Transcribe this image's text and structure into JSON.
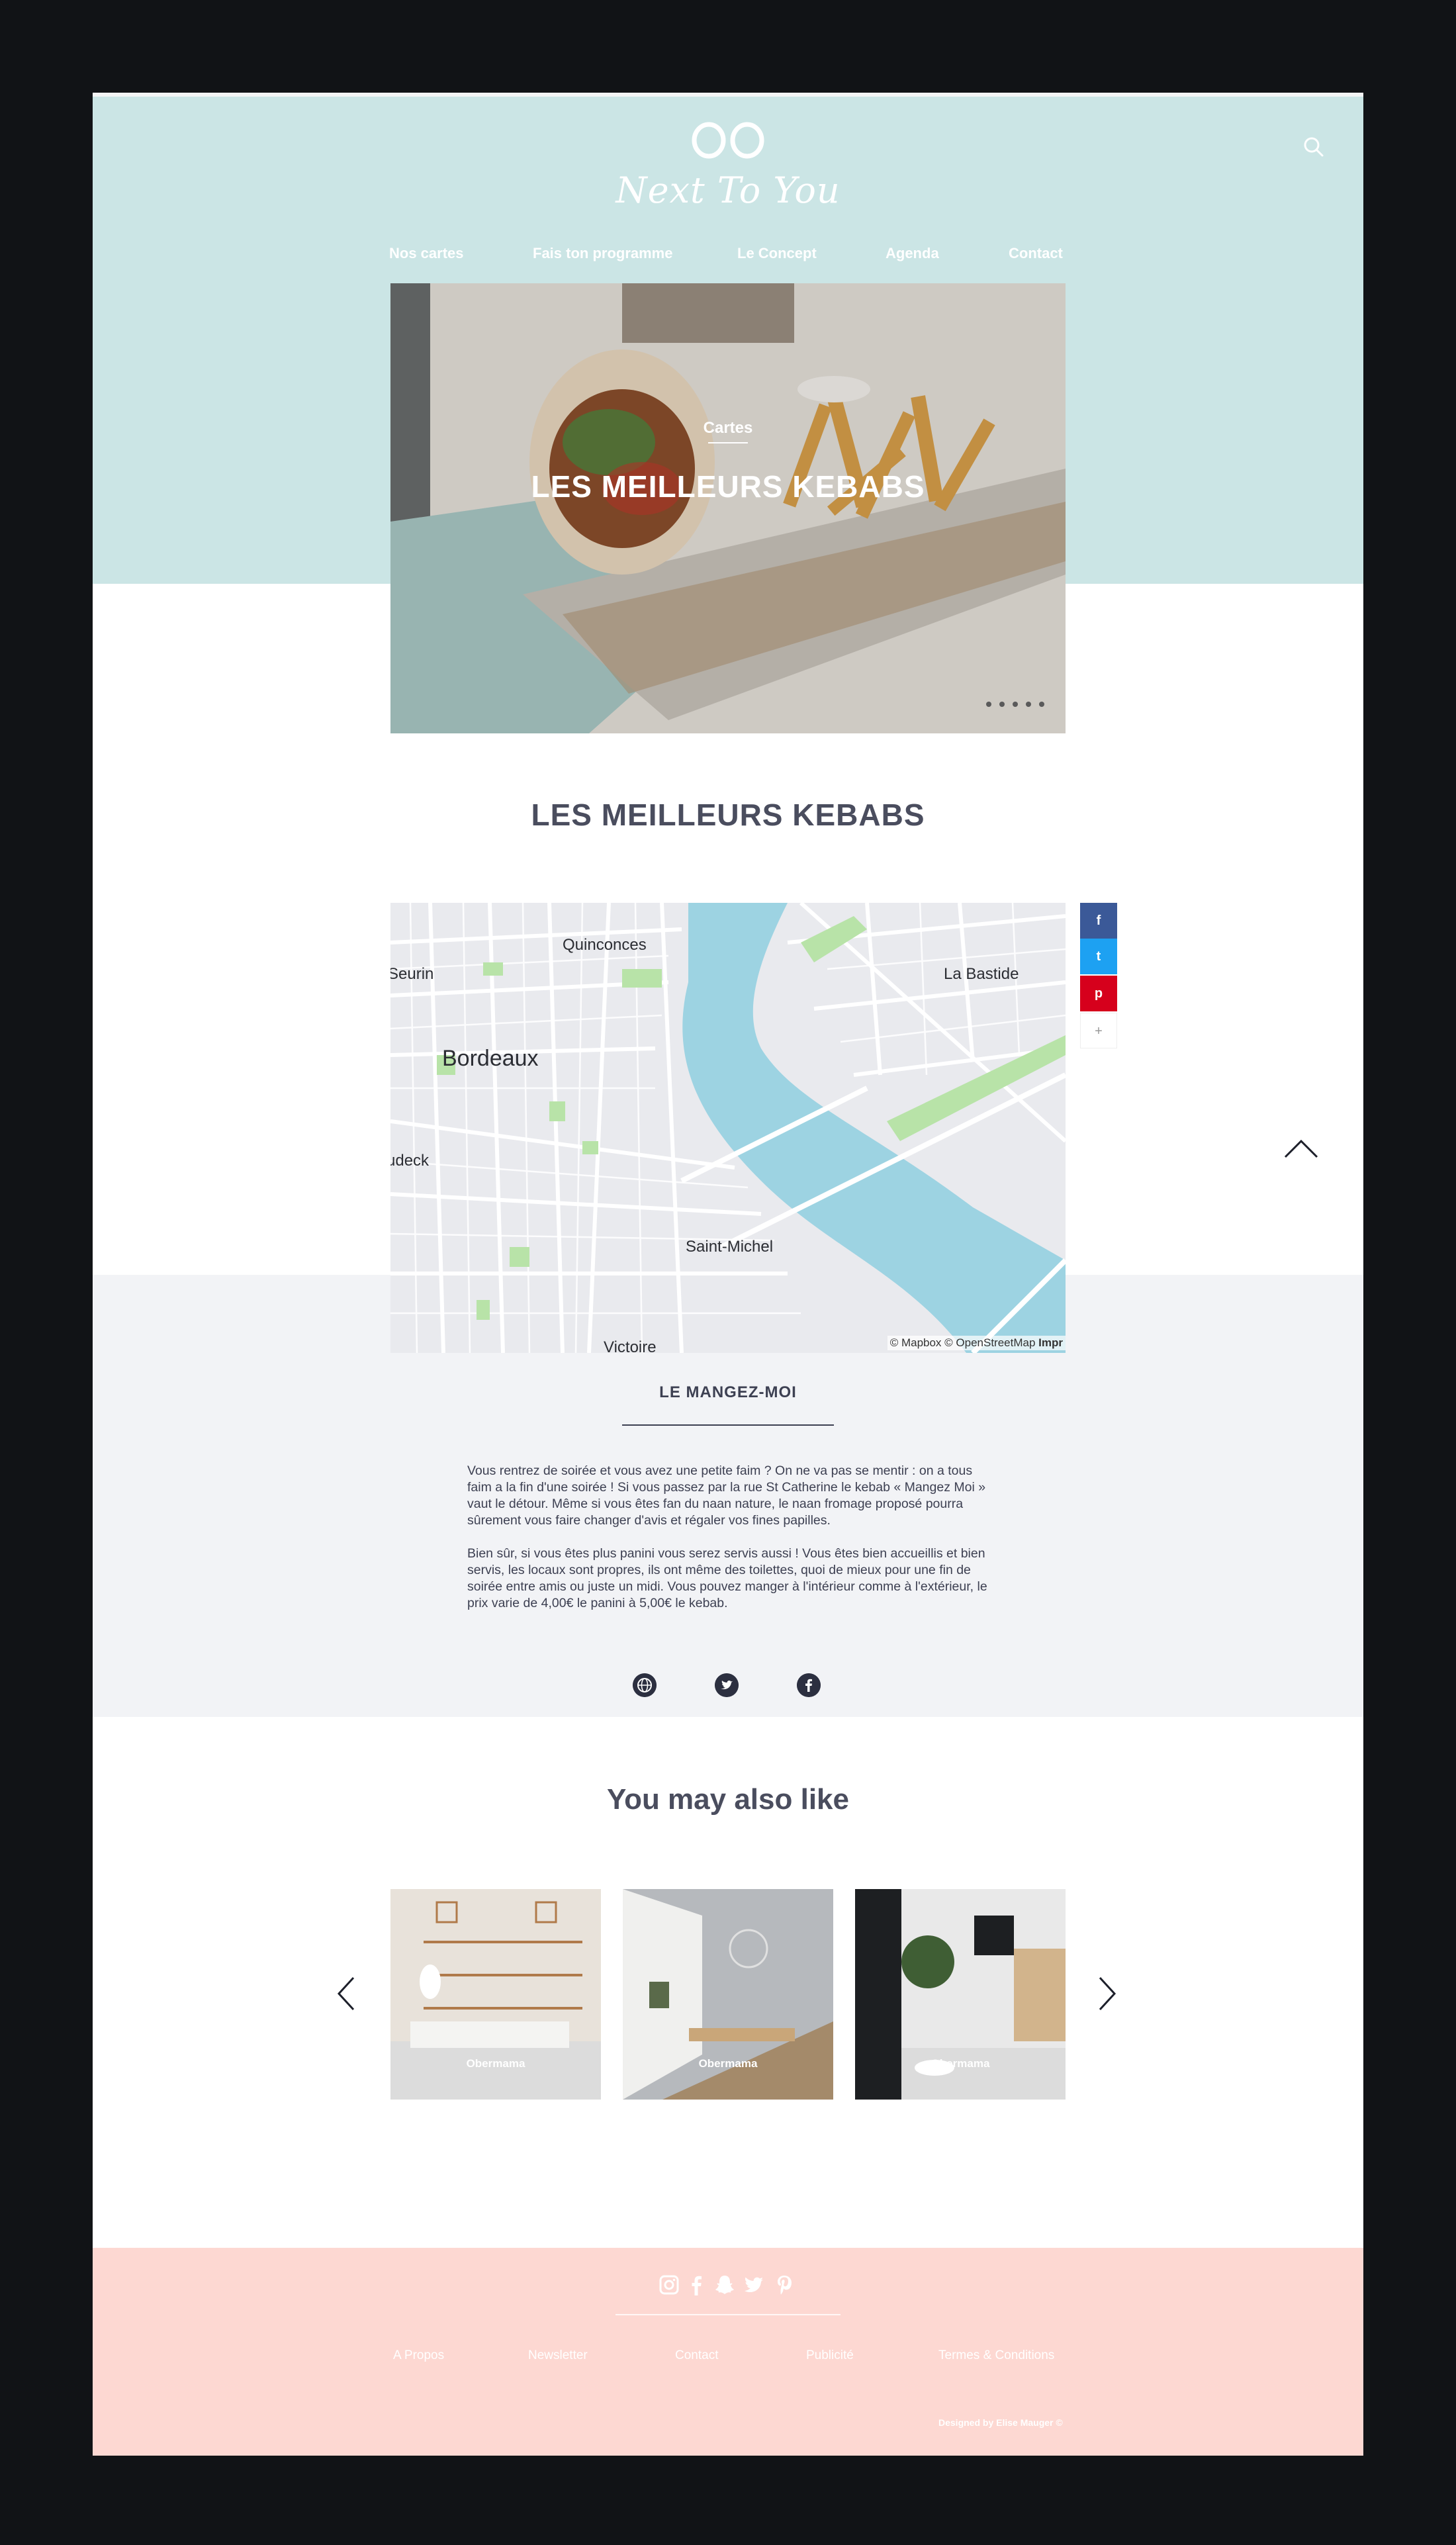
{
  "brand": {
    "name": "Next To You"
  },
  "nav": {
    "items": [
      {
        "label": "Nos cartes"
      },
      {
        "label": "Fais ton programme"
      },
      {
        "label": "Le Concept"
      },
      {
        "label": "Agenda"
      },
      {
        "label": "Contact"
      }
    ]
  },
  "hero": {
    "category": "Cartes",
    "title": "LES MEILLEURS KEBABS",
    "slide_count": 5
  },
  "article": {
    "title": "LES MEILLEURS KEBABS"
  },
  "map": {
    "labels": {
      "quinconces": "Quinconces",
      "seurin": "Seurin",
      "la_bastide": "La Bastide",
      "bordeaux": "Bordeaux",
      "udeck": "udeck",
      "saint_michel": "Saint-Michel",
      "victoire": "Victoire"
    },
    "attribution": "© Mapbox © OpenStreetMap",
    "attribution_link": "Impr"
  },
  "share": {
    "facebook": "f",
    "twitter": "t",
    "pinterest": "p",
    "more": "+"
  },
  "restaurant": {
    "name": "LE MANGEZ-MOI",
    "paragraphs": [
      "Vous rentrez de soirée et vous avez une petite faim ? On ne va pas se mentir : on a tous faim a la fin d'une soirée ! Si vous passez par la rue St Catherine le kebab « Mangez Moi » vaut le détour. Même si vous êtes fan du naan nature, le naan fromage proposé pourra sûrement vous faire changer d'avis et régaler vos fines papilles.",
      "Bien sûr, si vous êtes plus panini vous serez servis aussi ! Vous êtes bien accueillis et bien servis, les locaux sont propres, ils ont même des toilettes, quoi de mieux pour une fin de soirée entre amis ou juste un midi. Vous pouvez manger à l'intérieur comme à l'extérieur, le prix varie de 4,00€ le panini à 5,00€ le kebab."
    ],
    "links": [
      "globe-icon",
      "twitter-icon",
      "facebook-icon"
    ]
  },
  "related": {
    "title": "You may also like",
    "cards": [
      {
        "label": "Obermama"
      },
      {
        "label": "Obermama"
      },
      {
        "label": "Obermama"
      }
    ]
  },
  "footer": {
    "social": [
      "instagram-icon",
      "facebook-icon",
      "snapchat-icon",
      "twitter-icon",
      "pinterest-icon"
    ],
    "links": [
      {
        "label": "A Propos"
      },
      {
        "label": "Newsletter"
      },
      {
        "label": "Contact"
      },
      {
        "label": "Publicité"
      },
      {
        "label": "Termes & Conditions"
      }
    ],
    "credit": "Designed by Elise Mauger ©"
  },
  "colors": {
    "header_bg": "#cbe5e5",
    "grey_band": "#f2f3f6",
    "footer_bg": "#fdd8d2",
    "text_dark": "#4a4d5e",
    "water": "#9dd3e2",
    "park": "#b8e3a8",
    "facebook": "#3b5998",
    "twitter": "#1da1f2",
    "pinterest": "#d6001c"
  }
}
